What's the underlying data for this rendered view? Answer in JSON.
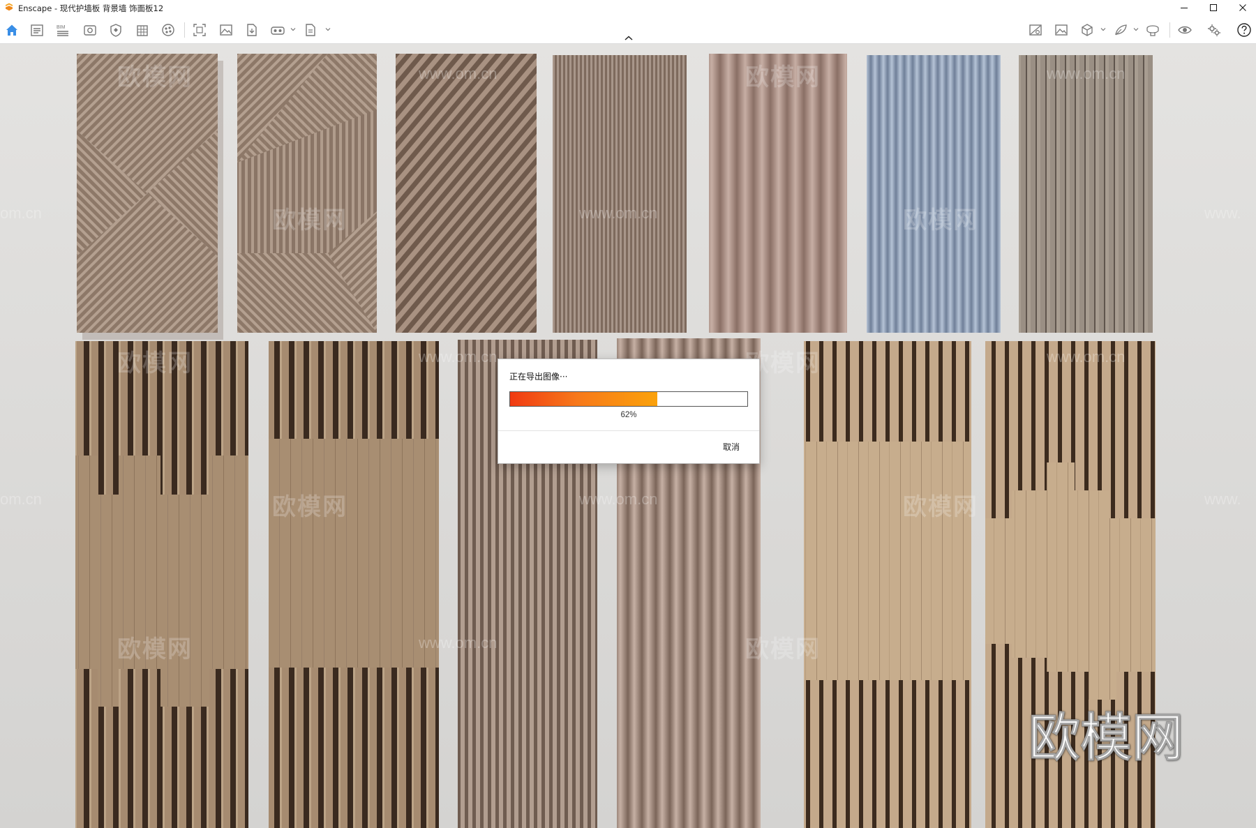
{
  "window": {
    "title": "Enscape - 现代护墙板 背景墙 饰面板12",
    "controls": [
      "minimize-icon",
      "maximize-icon",
      "close-icon"
    ]
  },
  "toolbar": {
    "left_tools": [
      "home-icon",
      "project-icon",
      "bim-icon",
      "view-icon",
      "asset-library-icon",
      "building-icon",
      "material-icon",
      "screenshot-icon",
      "image-icon",
      "export-document-icon",
      "vr-headset-icon",
      "export-file-icon"
    ],
    "right_tools": [
      "atmosphere-icon",
      "image-settings-icon",
      "cube-icon",
      "feedback-icon",
      "collaboration-icon",
      "visibility-icon",
      "settings-icon",
      "help-icon"
    ]
  },
  "watermarks": {
    "brand_cn": "欧模网",
    "site_partial_left": "om.cn",
    "site_partial_right": "www.",
    "site": "www.om.cn"
  },
  "export_dialog": {
    "title": "正在导出图像···",
    "progress": 0.62,
    "progress_label": "62%",
    "cancel_label": "取消"
  },
  "colors": {
    "progress_start": "#f03a12",
    "progress_end": "#fba20b",
    "home_icon": "#3a8ee6",
    "logo": "#f5a623"
  }
}
